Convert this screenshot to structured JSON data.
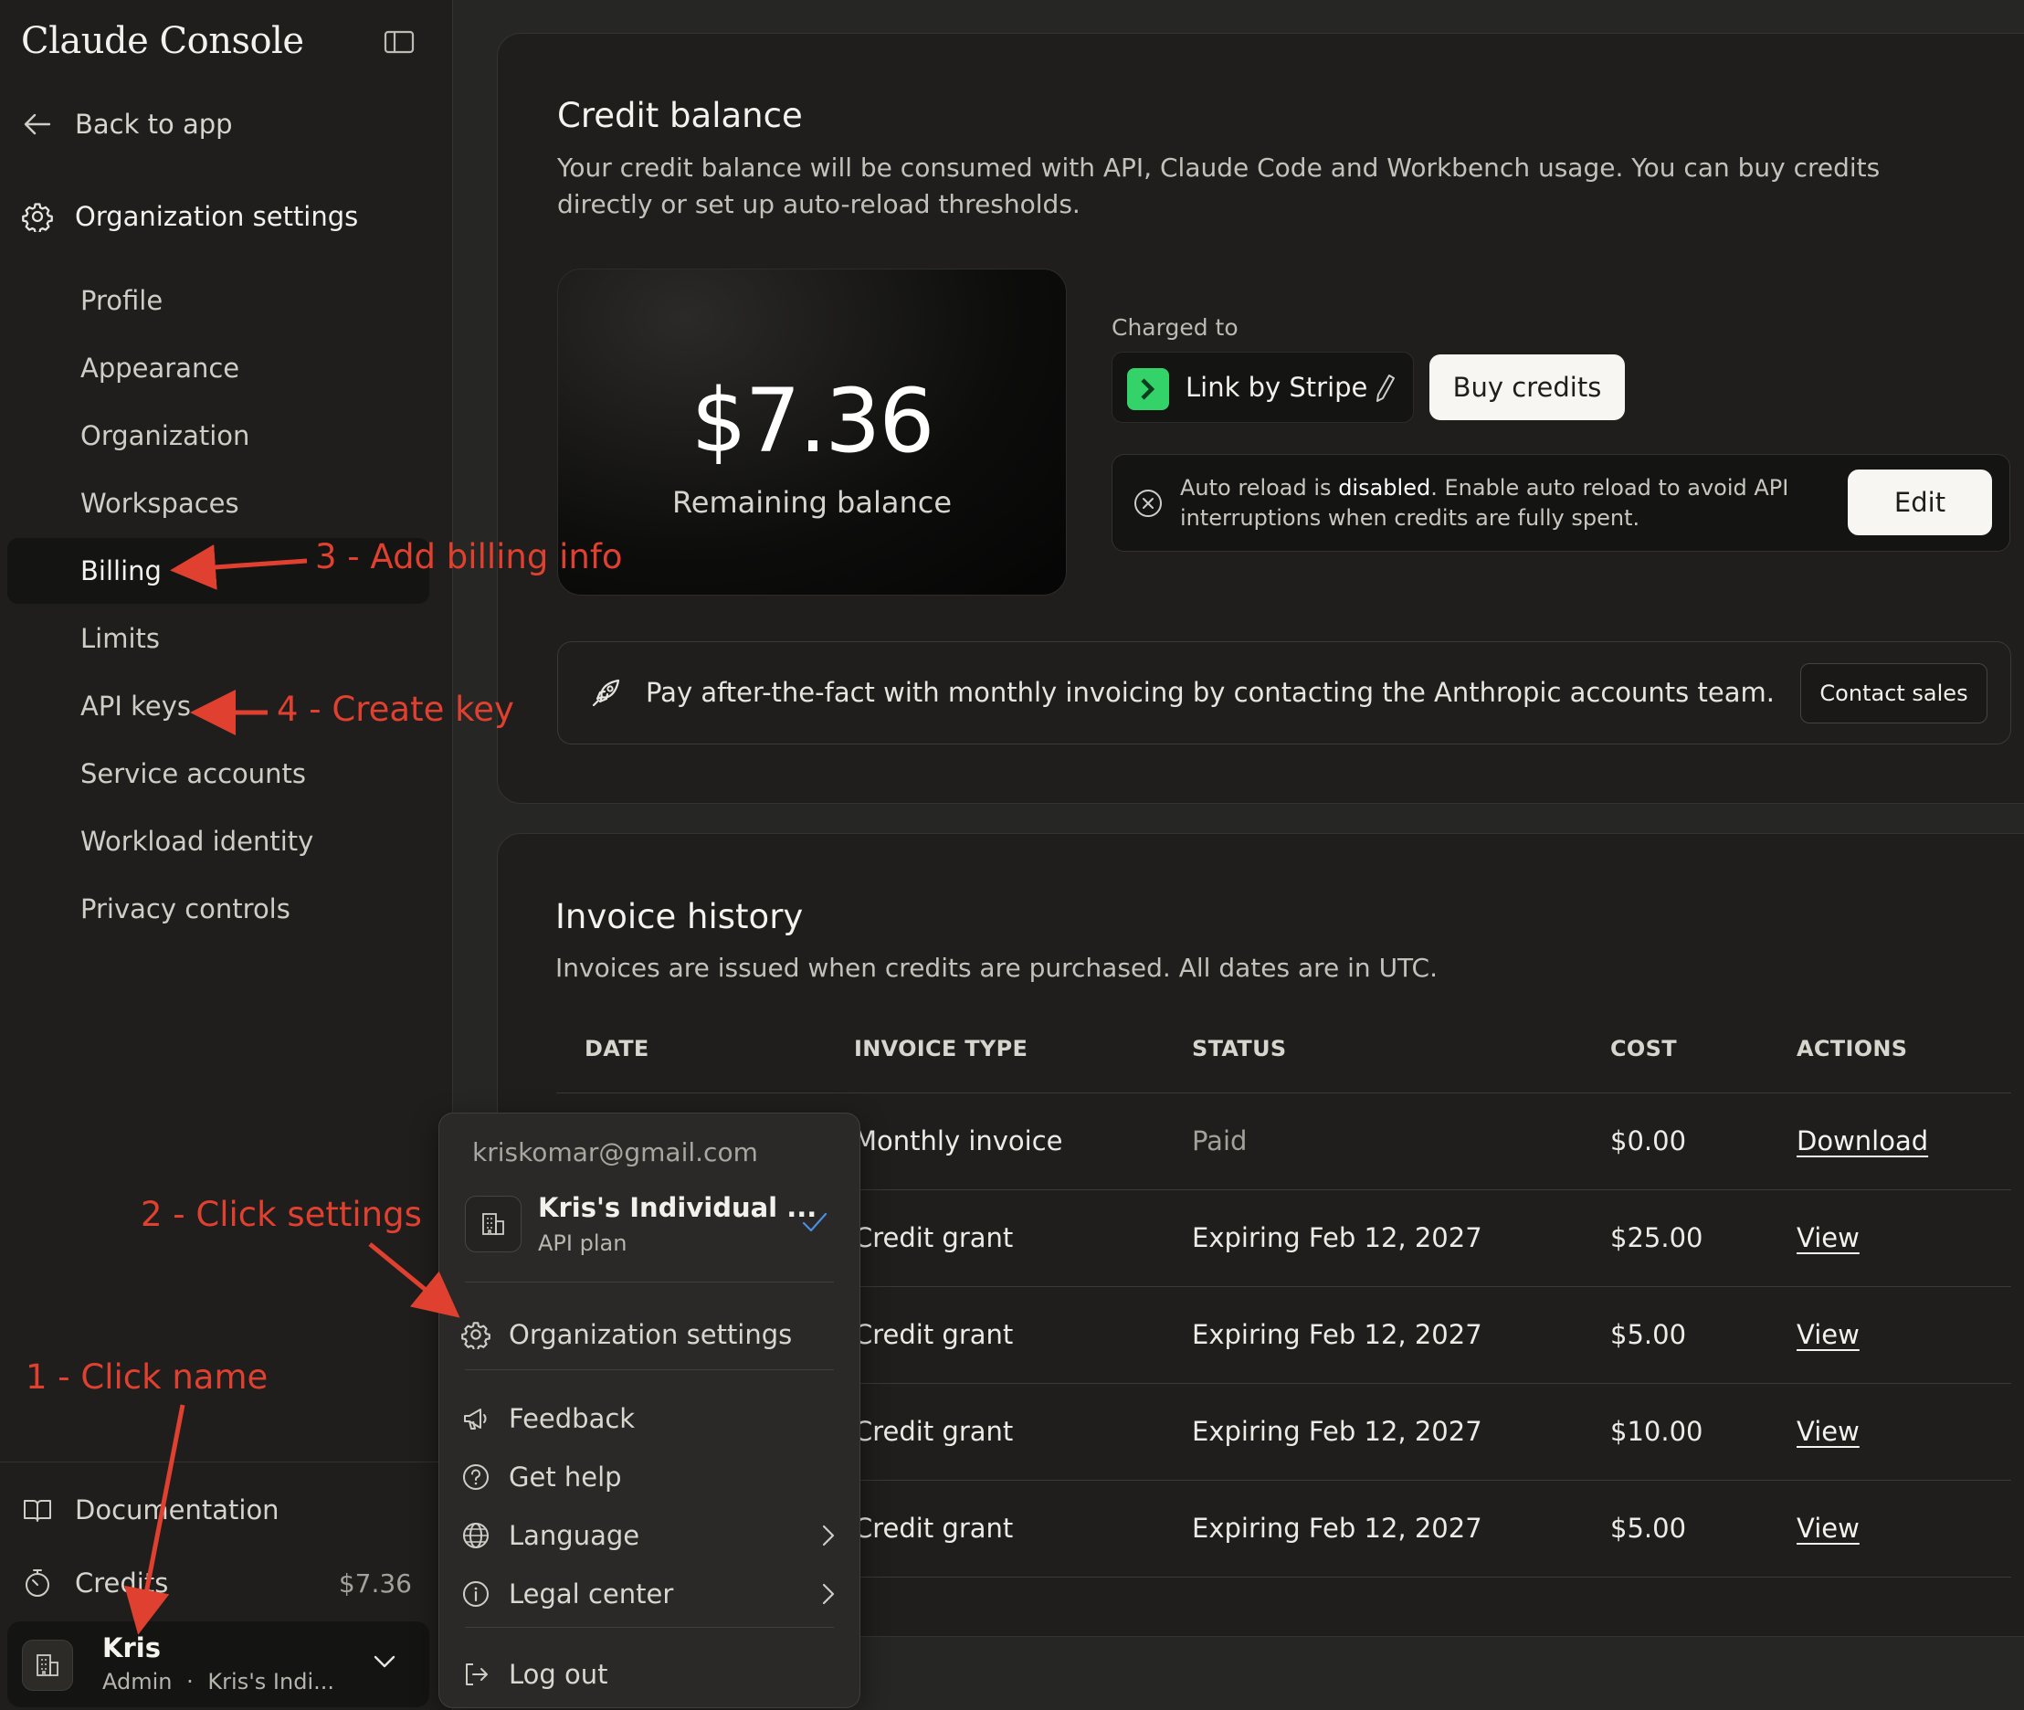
{
  "sidebar": {
    "brand": "Claude Console",
    "back_label": "Back to app",
    "section_label": "Organization settings",
    "items": [
      {
        "label": "Profile"
      },
      {
        "label": "Appearance"
      },
      {
        "label": "Organization"
      },
      {
        "label": "Workspaces"
      },
      {
        "label": "Billing"
      },
      {
        "label": "Limits"
      },
      {
        "label": "API keys"
      },
      {
        "label": "Service accounts"
      },
      {
        "label": "Workload identity"
      },
      {
        "label": "Privacy controls"
      }
    ],
    "active_item": "Billing",
    "documentation_label": "Documentation",
    "credits_label": "Credits",
    "credits_amount": "$7.36",
    "user": {
      "name": "Kris",
      "role": "Admin",
      "separator": "·",
      "org_short": "Kris's Indi..."
    }
  },
  "credit_balance": {
    "title": "Credit balance",
    "description": "Your credit balance will be consumed with API, Claude Code and Workbench usage. You can buy credits directly or set up auto-reload thresholds.",
    "amount": "$7.36",
    "amount_label": "Remaining balance",
    "charged_to_label": "Charged to",
    "payment_method": "Link by Stripe",
    "buy_button": "Buy credits",
    "auto_reload": {
      "prefix": "Auto reload is ",
      "state": "disabled",
      "suffix": ". Enable auto reload to avoid API interruptions when credits are fully spent.",
      "edit_button": "Edit"
    },
    "invoicing_banner": "Pay after-the-fact with monthly invoicing by contacting the Anthropic accounts team.",
    "contact_button": "Contact sales"
  },
  "invoice_history": {
    "title": "Invoice history",
    "description": "Invoices are issued when credits are purchased. All dates are in UTC.",
    "columns": [
      "DATE",
      "INVOICE TYPE",
      "STATUS",
      "COST",
      "ACTIONS"
    ],
    "rows": [
      {
        "type": "Monthly invoice",
        "status": "Paid",
        "cost": "$0.00",
        "action": "Download"
      },
      {
        "type": "Credit grant",
        "status": "Expiring Feb 12, 2027",
        "cost": "$25.00",
        "action": "View"
      },
      {
        "type": "Credit grant",
        "status": "Expiring Feb 12, 2027",
        "cost": "$5.00",
        "action": "View"
      },
      {
        "type": "Credit grant",
        "status": "Expiring Feb 12, 2027",
        "cost": "$10.00",
        "action": "View"
      },
      {
        "type": "Credit grant",
        "status": "Expiring Feb 12, 2027",
        "cost": "$5.00",
        "action": "View"
      }
    ]
  },
  "user_menu": {
    "email": "kriskomar@gmail.com",
    "org_name": "Kris's Individual ...",
    "org_plan": "API plan",
    "items": {
      "org_settings": "Organization settings",
      "feedback": "Feedback",
      "help": "Get help",
      "language": "Language",
      "legal": "Legal center",
      "logout": "Log out"
    }
  },
  "annotations": {
    "step1": "1 - Click name",
    "step2": "2 - Click settings",
    "step3": "3 - Add billing info",
    "step4": "4 - Create key"
  },
  "colors": {
    "background": "#262624",
    "sidebar": "#1f1e1c",
    "annotation": "#e0402f",
    "stripe_green": "#33d36a",
    "check_blue": "#4a8fe0"
  }
}
